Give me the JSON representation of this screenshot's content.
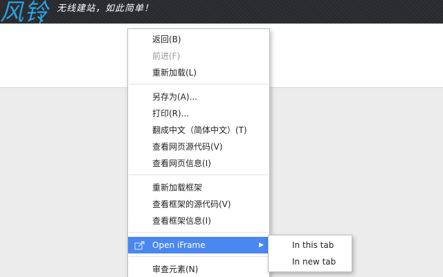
{
  "header": {
    "logo_text": "风铃",
    "slogan": "无线建站，如此简单！"
  },
  "context_menu": {
    "items": [
      {
        "label": "返回(B)",
        "disabled": false
      },
      {
        "label": "前进(F)",
        "disabled": true
      },
      {
        "label": "重新加载(L)",
        "disabled": false
      },
      {
        "label": "另存为(A)...",
        "disabled": false
      },
      {
        "label": "打印(R)...",
        "disabled": false
      },
      {
        "label": "翻成中文（简体中文）(T)",
        "disabled": false
      },
      {
        "label": "查看网页源代码(V)",
        "disabled": false
      },
      {
        "label": "查看网页信息(I)",
        "disabled": false
      },
      {
        "label": "重新加载框架",
        "disabled": false
      },
      {
        "label": "查看框架的源代码(V)",
        "disabled": false
      },
      {
        "label": "查看框架信息(I)",
        "disabled": false
      },
      {
        "label": "Open iFrame",
        "disabled": false,
        "highlighted": true,
        "icon": "share-icon",
        "has_submenu": true
      },
      {
        "label": "审查元素(N)",
        "disabled": false
      }
    ]
  },
  "submenu": {
    "items": [
      {
        "label": "In this tab"
      },
      {
        "label": "In new tab"
      }
    ]
  },
  "colors": {
    "header_bg": "#27292d",
    "logo_blue": "#2aa1de",
    "highlight": "#4a87ee",
    "page_bg": "#ececec"
  }
}
